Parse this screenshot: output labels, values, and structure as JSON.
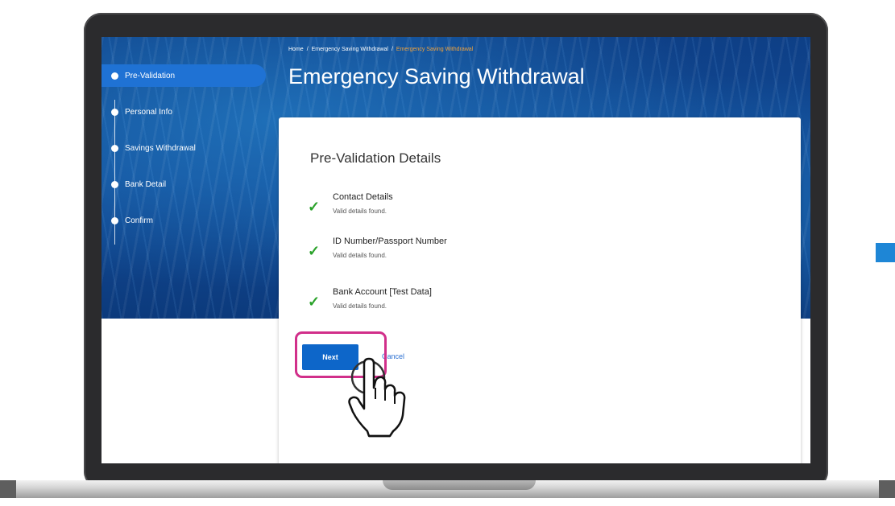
{
  "breadcrumb": {
    "home": "Home",
    "parent": "Emergency Saving Withdrawal",
    "current": "Emergency Saving Withdrawal",
    "separator": "/"
  },
  "page_title": "Emergency Saving Withdrawal",
  "steps": [
    {
      "label": "Pre-Validation",
      "active": true
    },
    {
      "label": "Personal Info",
      "active": false
    },
    {
      "label": "Savings Withdrawal",
      "active": false
    },
    {
      "label": "Bank Detail",
      "active": false
    },
    {
      "label": "Confirm",
      "active": false
    }
  ],
  "card": {
    "title": "Pre-Validation Details",
    "items": [
      {
        "title": "Contact Details",
        "status": "Valid details found."
      },
      {
        "title": "ID Number/Passport Number",
        "status": "Valid details found."
      },
      {
        "title": "Bank Account [Test Data]",
        "status": "Valid details found."
      }
    ],
    "next_label": "Next",
    "cancel_label": "Cancel"
  },
  "icons": {
    "check": "checkmark-icon",
    "cursor": "hand-pointer-icon"
  },
  "colors": {
    "accent": "#1f72d4",
    "button": "#0d66c9",
    "check": "#2aa22a",
    "breadcrumb_current": "#f2a33c",
    "highlight": "#d12f8a"
  }
}
